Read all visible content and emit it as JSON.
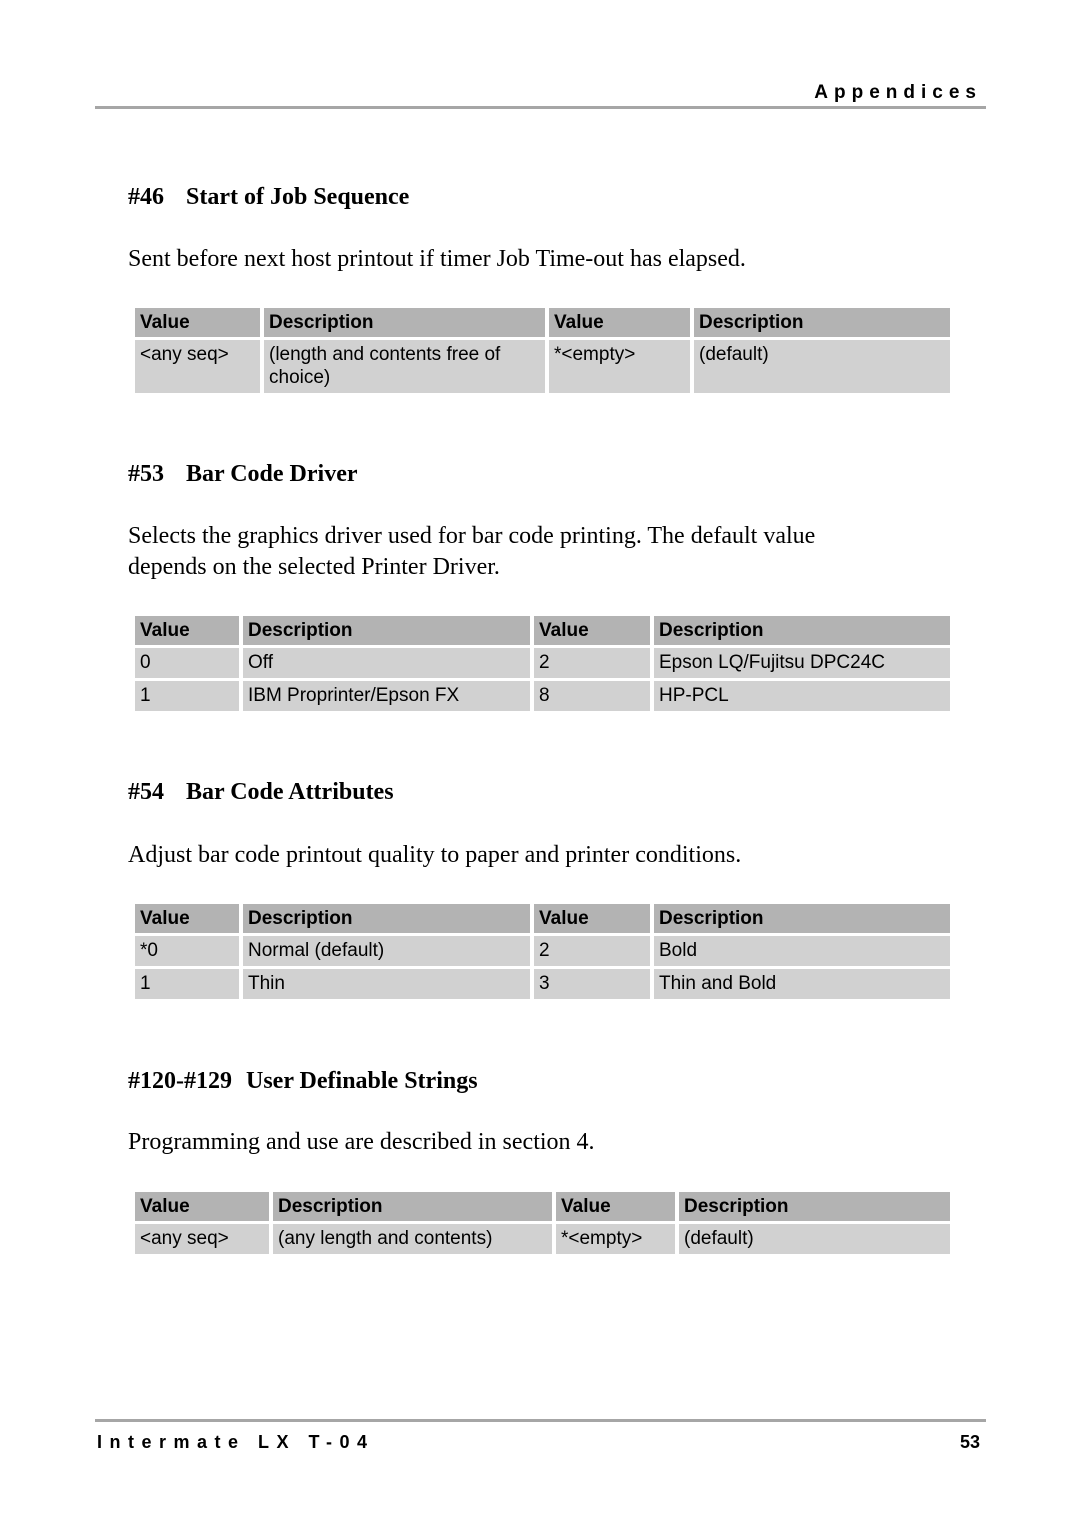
{
  "header": {
    "section": "Appendices"
  },
  "footer": {
    "product": "Intermate LX T-04",
    "page_number": "53"
  },
  "sections": [
    {
      "number": "#46",
      "title": "Start of Job Sequence",
      "description": "Sent before next host printout if timer Job Time-out has elapsed.",
      "columns": [
        "Value",
        "Description",
        "Value",
        "Description"
      ],
      "rows": [
        [
          "<any seq>",
          "(length and contents free of choice)",
          "*<empty>",
          "(default)"
        ]
      ]
    },
    {
      "number": "#53",
      "title": "Bar Code Driver",
      "description": "Selects the graphics driver used for bar code printing. The default value depends on the selected Printer Driver.",
      "columns": [
        "Value",
        "Description",
        "Value",
        "Description"
      ],
      "rows": [
        [
          "0",
          "Off",
          "2",
          "Epson LQ/Fujitsu DPC24C"
        ],
        [
          "1",
          "IBM Proprinter/Epson FX",
          "8",
          "HP-PCL"
        ]
      ]
    },
    {
      "number": "#54",
      "title": "Bar Code Attributes",
      "description": "Adjust bar code printout quality to paper and printer conditions.",
      "columns": [
        "Value",
        "Description",
        "Value",
        "Description"
      ],
      "rows": [
        [
          "*0",
          "Normal (default)",
          "2",
          "Bold"
        ],
        [
          "1",
          "Thin",
          "3",
          "Thin and Bold"
        ]
      ]
    },
    {
      "number": "#120-#129",
      "title": "User Definable Strings",
      "description": "Programming and use are described in section 4.",
      "columns": [
        "Value",
        "Description",
        "Value",
        "Description"
      ],
      "rows": [
        [
          "<any seq>",
          "(any length and contents)",
          "*<empty>",
          "(default)"
        ]
      ]
    }
  ]
}
